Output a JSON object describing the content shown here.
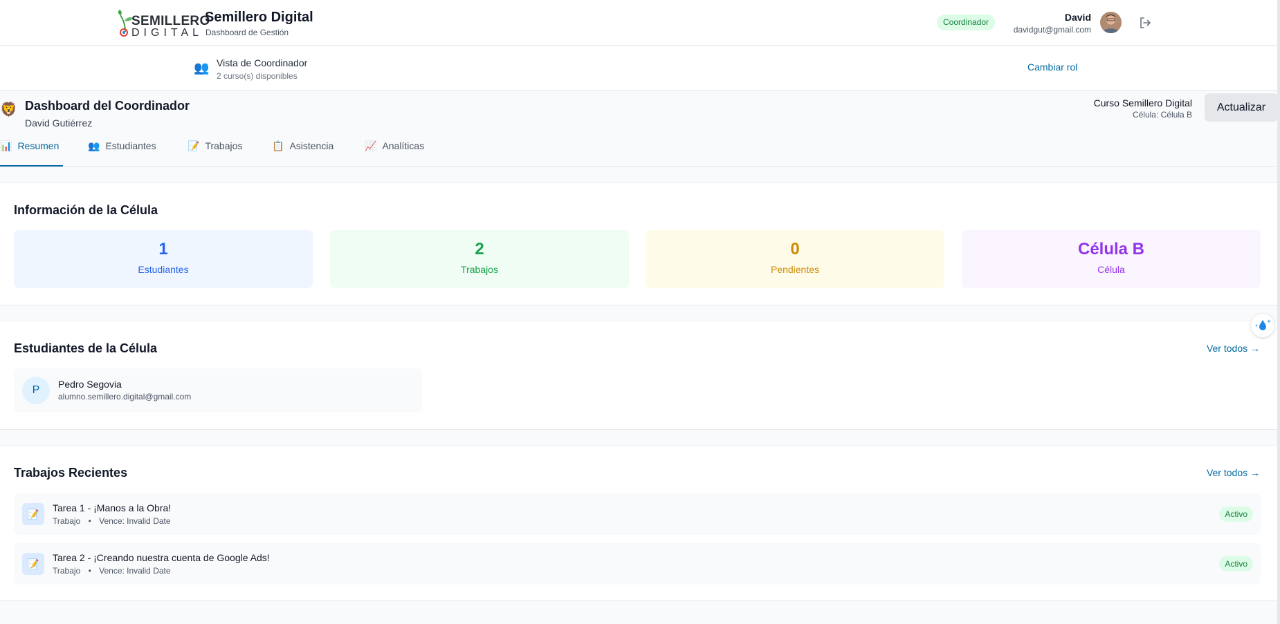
{
  "header": {
    "logo_top": "SEMILLERO",
    "logo_bottom": "DIGITAL",
    "title": "Semillero Digital",
    "subtitle": "Dashboard de Gestión",
    "role_badge": "Coordinador",
    "user_name": "David",
    "user_email": "davidgut@gmail.com"
  },
  "rolebar": {
    "title": "Vista de Coordinador",
    "subtitle": "2 curso(s) disponibles",
    "change_role": "Cambiar rol"
  },
  "dashboard": {
    "title": "Dashboard del Coordinador",
    "user": "David Gutiérrez",
    "course": "Curso Semillero Digital",
    "cell": "Célula: Célula B",
    "refresh_label": "Actualizar"
  },
  "tabs": [
    {
      "icon": "📊",
      "label": "Resumen"
    },
    {
      "icon": "👥",
      "label": "Estudiantes"
    },
    {
      "icon": "📝",
      "label": "Trabajos"
    },
    {
      "icon": "📋",
      "label": "Asistencia"
    },
    {
      "icon": "📈",
      "label": "Analíticas"
    }
  ],
  "cell_info": {
    "title": "Información de la Célula",
    "stats": [
      {
        "value": "1",
        "label": "Estudiantes"
      },
      {
        "value": "2",
        "label": "Trabajos"
      },
      {
        "value": "0",
        "label": "Pendientes"
      },
      {
        "value": "Célula B",
        "label": "Célula"
      }
    ]
  },
  "students": {
    "title": "Estudiantes de la Célula",
    "see_all": "Ver todos →",
    "items": [
      {
        "initial": "P",
        "name": "Pedro Segovia",
        "email": "alumno.semillero.digital@gmail.com"
      }
    ]
  },
  "works": {
    "title": "Trabajos Recientes",
    "see_all": "Ver todos →",
    "items": [
      {
        "title": "Tarea 1 - ¡Manos a la Obra!",
        "type": "Trabajo",
        "separator": "•",
        "due": "Vence: Invalid Date",
        "status": "Activo"
      },
      {
        "title": "Tarea 2 - ¡Creando nuestra cuenta de Google Ads!",
        "type": "Trabajo",
        "separator": "•",
        "due": "Vence: Invalid Date",
        "status": "Activo"
      }
    ]
  },
  "colors": {
    "accent": "#0369a1",
    "stat_blue": "#2563eb",
    "stat_green": "#16a34a",
    "stat_yellow": "#ca8a04",
    "stat_purple": "#9333ea"
  }
}
